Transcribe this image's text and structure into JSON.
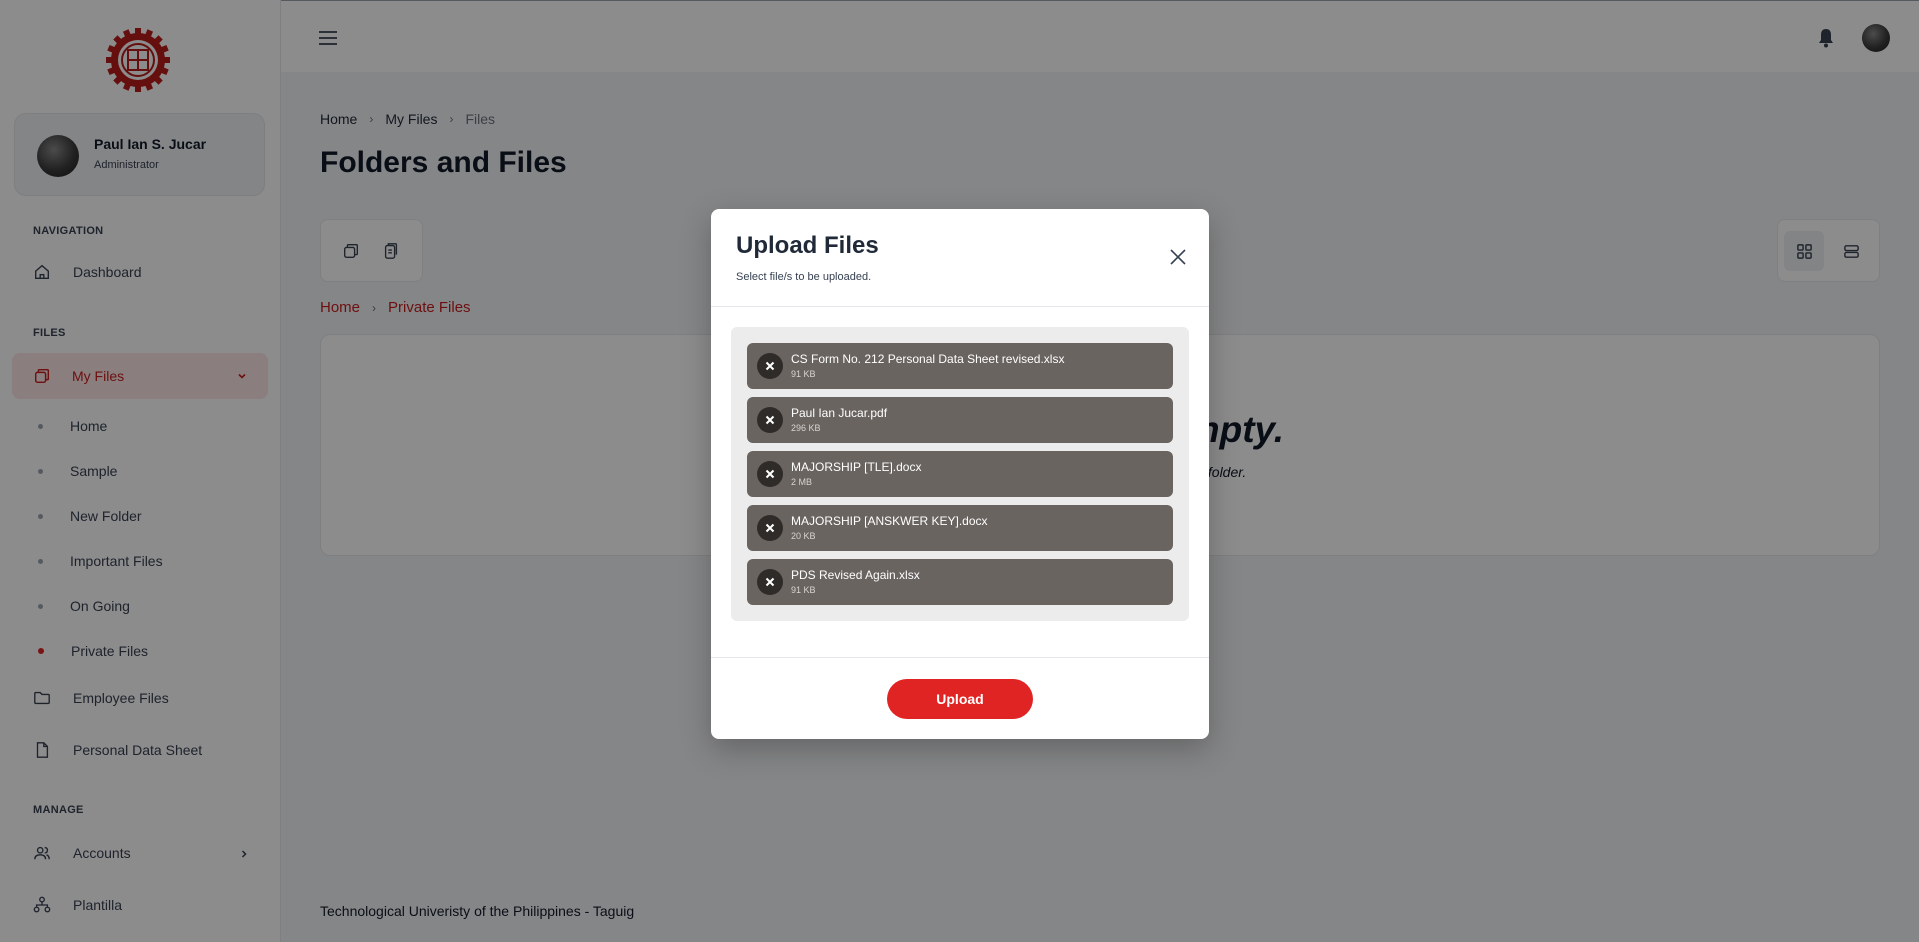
{
  "sidebar": {
    "profile": {
      "name": "Paul Ian S. Jucar",
      "role": "Administrator"
    },
    "sections": {
      "navigation": "NAVIGATION",
      "files": "FILES",
      "manage": "MANAGE"
    },
    "items": {
      "dashboard": "Dashboard",
      "my_files": "My Files",
      "employee_files": "Employee Files",
      "personal_data_sheet": "Personal Data Sheet",
      "accounts": "Accounts",
      "plantilla": "Plantilla"
    },
    "my_files_children": [
      "Home",
      "Sample",
      "New Folder",
      "Important Files",
      "On Going",
      "Private Files"
    ]
  },
  "breadcrumb": {
    "home": "Home",
    "my_files": "My Files",
    "current": "Files"
  },
  "page_title": "Folders and Files",
  "folder_breadcrumb": {
    "home": "Home",
    "current": "Private Files"
  },
  "empty_state": {
    "title": "npty.",
    "subtitle": "s folder."
  },
  "footer": "Technological Univeristy of the Philippines - Taguig",
  "modal": {
    "title": "Upload Files",
    "subtitle": "Select file/s to be uploaded.",
    "files": [
      {
        "name": "CS Form No. 212 Personal Data Sheet revised.xlsx",
        "size": "91 KB"
      },
      {
        "name": "Paul Ian Jucar.pdf",
        "size": "296 KB"
      },
      {
        "name": "MAJORSHIP [TLE].docx",
        "size": "2 MB"
      },
      {
        "name": "MAJORSHIP [ANSKWER KEY].docx",
        "size": "20 KB"
      },
      {
        "name": "PDS Revised Again.xlsx",
        "size": "91 KB"
      }
    ],
    "upload_label": "Upload"
  },
  "colors": {
    "accent": "#e02424",
    "active_bg": "#fde5e5",
    "file_item_bg": "#6a6461"
  },
  "icons": [
    "logo-seal",
    "home-icon",
    "files-icon",
    "chevron-down-icon",
    "folder-icon",
    "document-icon",
    "users-icon",
    "chevron-right-icon",
    "org-chart-icon",
    "menu-icon",
    "bell-icon",
    "copy-icon",
    "paste-icon",
    "grid-view-icon",
    "list-view-icon",
    "close-icon"
  ]
}
